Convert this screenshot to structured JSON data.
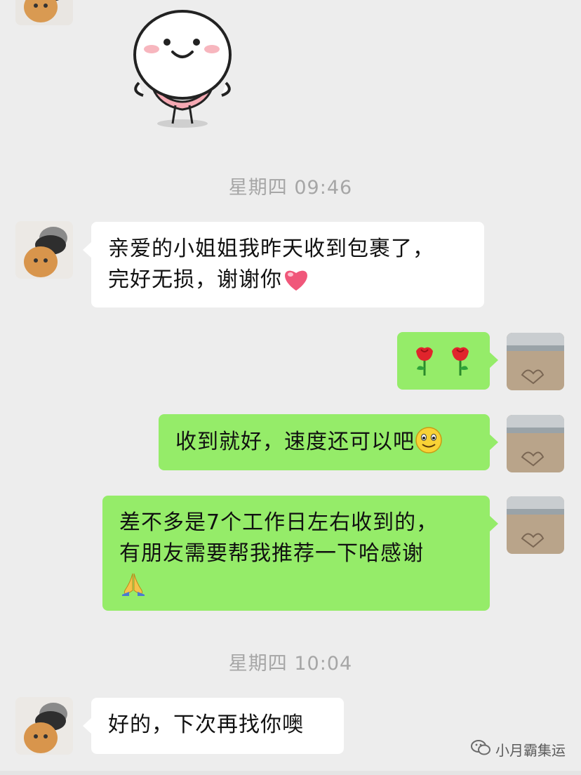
{
  "chat": {
    "messages": [
      {
        "type": "sticker",
        "sender": "other",
        "sticker_icon": "smiling-dumpling-sticker"
      },
      {
        "type": "timestamp",
        "text": "星期四 09:46"
      },
      {
        "type": "text",
        "sender": "other",
        "lines": [
          "亲爱的小姐姐我昨天收到包裹了，",
          "完好无损，谢谢你"
        ],
        "trailing_icon": "heart-emoji"
      },
      {
        "type": "emoji",
        "sender": "me",
        "icons": [
          "rose-emoji",
          "rose-emoji"
        ]
      },
      {
        "type": "text",
        "sender": "me",
        "lines": [
          "收到就好，速度还可以吧"
        ],
        "trailing_icon": "smile-emoji"
      },
      {
        "type": "text",
        "sender": "me",
        "lines": [
          "差不多是7个工作日左右收到的，",
          "有朋友需要帮我推荐一下哈感谢"
        ],
        "trailing_icon": "pray-emoji"
      },
      {
        "type": "timestamp",
        "text": "星期四 10:04"
      },
      {
        "type": "text",
        "sender": "other",
        "lines": [
          "好的，下次再找你噢"
        ]
      }
    ]
  },
  "avatars": {
    "other": "cat-avatar",
    "me": "beach-avatar"
  },
  "watermark": {
    "icon": "wechat-official-account-icon",
    "text": "小月霸集运"
  },
  "colors": {
    "background": "#ededed",
    "incoming_bubble": "#ffffff",
    "outgoing_bubble": "#95ec69",
    "timestamp": "#a6a6a6"
  }
}
